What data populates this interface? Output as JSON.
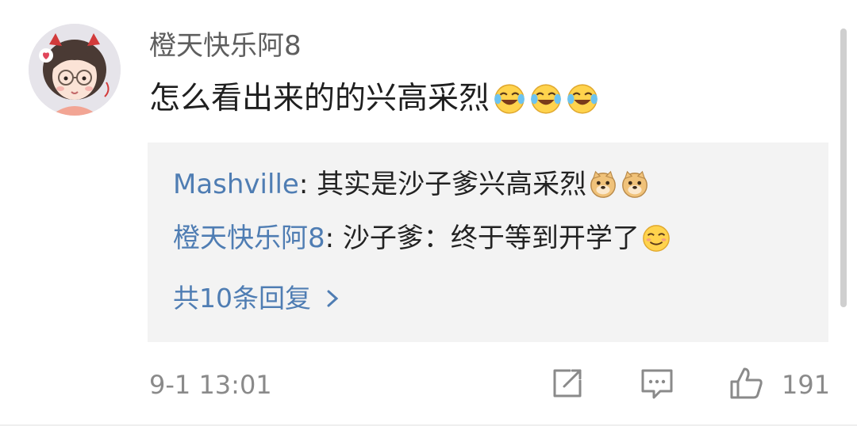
{
  "comment": {
    "username": "橙天快乐阿8",
    "text": "怎么看出来的的兴高采烈",
    "emojis": [
      "laugh-cry-icon",
      "laugh-cry-icon",
      "laugh-cry-icon"
    ]
  },
  "replies": [
    {
      "name": "Mashville",
      "separator": ": ",
      "text": "其实是沙子爹兴高采烈",
      "emojis": [
        "doge-icon",
        "doge-icon"
      ]
    },
    {
      "name": "橙天快乐阿8",
      "separator": ": ",
      "text": "沙子爹：终于等到开学了",
      "emojis": [
        "smug-smile-icon"
      ]
    }
  ],
  "more_replies": "共10条回复",
  "timestamp": "9-1 13:01",
  "actions": {
    "share_icon": "share-edit-icon",
    "comment_icon": "comment-icon",
    "like_icon": "thumbs-up-icon",
    "like_count": "191"
  },
  "colors": {
    "link": "#4f7db3",
    "reply_bg": "#f3f3f3",
    "meta": "#8a8a8a"
  }
}
